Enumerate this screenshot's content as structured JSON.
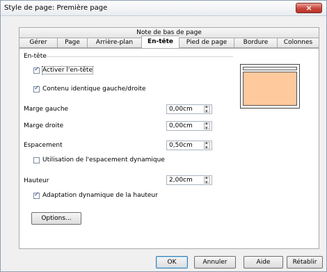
{
  "window": {
    "title": "Style de page: Première page",
    "close_icon": "×"
  },
  "tabs": {
    "top": "Note de bas de page",
    "items": [
      {
        "label": "Gérer"
      },
      {
        "label": "Page"
      },
      {
        "label": "Arrière-plan"
      },
      {
        "label": "En-tête",
        "active": true
      },
      {
        "label": "Pied de page"
      },
      {
        "label": "Bordure"
      },
      {
        "label": "Colonnes"
      }
    ]
  },
  "header_section": {
    "group_label": "En-tête",
    "activate": {
      "label": "Activer l'en-tête",
      "checked": true
    },
    "same_content": {
      "label": "Contenu identique gauche/droite",
      "checked": true
    },
    "left_margin": {
      "label": "Marge gauche",
      "value": "0,00cm"
    },
    "right_margin": {
      "label": "Marge droite",
      "value": "0,00cm"
    },
    "spacing": {
      "label": "Espacement",
      "value": "0,50cm"
    },
    "dynamic_spacing": {
      "label": "Utilisation de l'espacement dynamique",
      "checked": false
    },
    "height": {
      "label": "Hauteur",
      "value": "2,00cm"
    },
    "auto_height": {
      "label": "Adaptation dynamique de la hauteur",
      "checked": true
    },
    "options_button": "Options..."
  },
  "buttons": {
    "ok": "OK",
    "cancel": "Annuler",
    "help": "Aide",
    "reset": "Rétablir"
  },
  "colors": {
    "preview_body": "#fec99d",
    "close_button": "#c9463a"
  }
}
